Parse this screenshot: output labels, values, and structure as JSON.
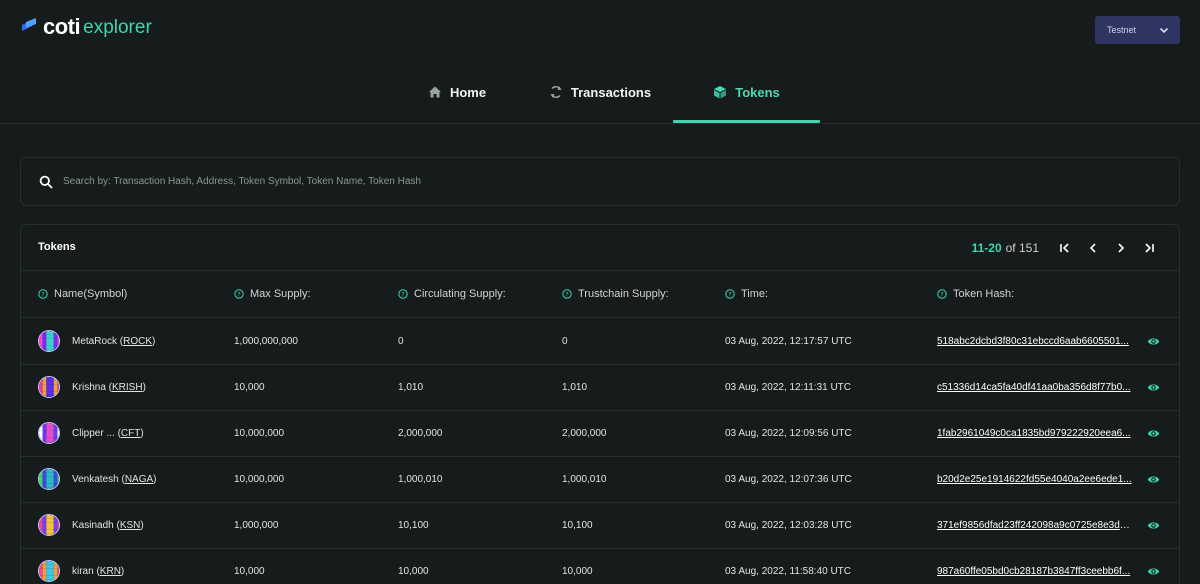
{
  "brand": {
    "name": "coti",
    "product": "explorer"
  },
  "network": {
    "selected": "Testnet"
  },
  "nav": {
    "tabs": [
      {
        "label": "Home"
      },
      {
        "label": "Transactions"
      },
      {
        "label": "Tokens"
      }
    ],
    "active": "Tokens"
  },
  "search": {
    "placeholder": "Search by: Transaction Hash, Address, Token Symbol, Token Name, Token Hash"
  },
  "tokens_panel": {
    "title": "Tokens",
    "pagination": {
      "range": "11-20",
      "of_label": "of 151"
    },
    "columns": [
      "Name(Symbol)",
      "Max Supply:",
      "Circulating Supply:",
      "Trustchain Supply:",
      "Time:",
      "Token Hash:"
    ],
    "rows": [
      {
        "name": "MetaRock",
        "symbol": "ROCK",
        "max_supply": "1,000,000,000",
        "circulating": "0",
        "trustchain": "0",
        "time": "03 Aug, 2022, 12:17:57 UTC",
        "hash": "518abc2dcbd3f80c31ebccd6aab6605501...",
        "avatar_colors": [
          "#f14ad6",
          "#7a2df0",
          "#3ad4d0"
        ]
      },
      {
        "name": "Krishna",
        "symbol": "KRISH",
        "max_supply": "10,000",
        "circulating": "1,010",
        "trustchain": "1,010",
        "time": "03 Aug, 2022, 12:11:31 UTC",
        "hash": "c51336d14ca5fa40df41aa0ba356d8f77b0...",
        "avatar_colors": [
          "#f0a23c",
          "#5b2ee8",
          "#e83ea6"
        ]
      },
      {
        "name": "Clipper ...",
        "symbol": "CFT",
        "max_supply": "10,000,000",
        "circulating": "2,000,000",
        "trustchain": "2,000,000",
        "time": "03 Aug, 2022, 12:09:56 UTC",
        "hash": "1fab2961049c0ca1835bd979222920eea6...",
        "avatar_colors": [
          "#e84bd0",
          "#ffffff",
          "#6a3df0"
        ]
      },
      {
        "name": "Venkatesh",
        "symbol": "NAGA",
        "max_supply": "10,000,000",
        "circulating": "1,000,010",
        "trustchain": "1,000,010",
        "time": "03 Aug, 2022, 12:07:36 UTC",
        "hash": "b20d2e25e1914622fd55e4040a2ee6ede1...",
        "avatar_colors": [
          "#3fd36b",
          "#3a4ae8",
          "#2fb8c8"
        ]
      },
      {
        "name": "Kasinadh",
        "symbol": "KSN",
        "max_supply": "1,000,000",
        "circulating": "10,100",
        "trustchain": "10,100",
        "time": "03 Aug, 2022, 12:03:28 UTC",
        "hash": "371ef9856dfad23ff242098a9c0725e8e3d5...",
        "avatar_colors": [
          "#7d3df0",
          "#f0c43c",
          "#e84aa0"
        ]
      },
      {
        "name": "kiran",
        "symbol": "KRN",
        "max_supply": "10,000",
        "circulating": "10,000",
        "trustchain": "10,000",
        "time": "03 Aug, 2022, 11:58:40 UTC",
        "hash": "987a60ffe05bd0cb28187b3847ff3ceebb6f...",
        "avatar_colors": [
          "#3ac8e8",
          "#f04a8a",
          "#f0a03c"
        ]
      }
    ]
  },
  "colors": {
    "accent": "#3fd3ae",
    "background": "#161c1c",
    "network_select": "#2e3562"
  },
  "icons": [
    "home-icon",
    "refresh-icon",
    "cube-icon",
    "search-icon",
    "chevron-down-icon",
    "help-circle-icon",
    "first-page-icon",
    "prev-page-icon",
    "next-page-icon",
    "last-page-icon",
    "eye-icon"
  ]
}
